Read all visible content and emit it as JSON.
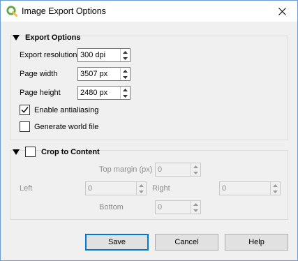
{
  "window": {
    "title": "Image Export Options",
    "app_icon": "qgis-logo-icon",
    "close_icon": "close-icon"
  },
  "export_options": {
    "title": "Export Options",
    "expanded": true,
    "resolution": {
      "label": "Export resolution",
      "value": "300 dpi"
    },
    "page_width": {
      "label": "Page width",
      "value": "3507 px"
    },
    "page_height": {
      "label": "Page height",
      "value": "2480 px"
    },
    "antialiasing": {
      "label": "Enable antialiasing",
      "checked": true
    },
    "world_file": {
      "label": "Generate world file",
      "checked": false
    }
  },
  "crop_to_content": {
    "title": "Crop to Content",
    "checked": false,
    "top_margin": {
      "label": "Top margin (px)",
      "value": "0"
    },
    "left": {
      "label": "Left",
      "value": "0"
    },
    "right": {
      "label": "Right",
      "value": "0"
    },
    "bottom": {
      "label": "Bottom",
      "value": "0"
    }
  },
  "buttons": {
    "save": "Save",
    "cancel": "Cancel",
    "help": "Help"
  },
  "colors": {
    "accent": "#0078d7",
    "window_border": "#6b9bd1",
    "qgis_green": "#5fa844"
  }
}
